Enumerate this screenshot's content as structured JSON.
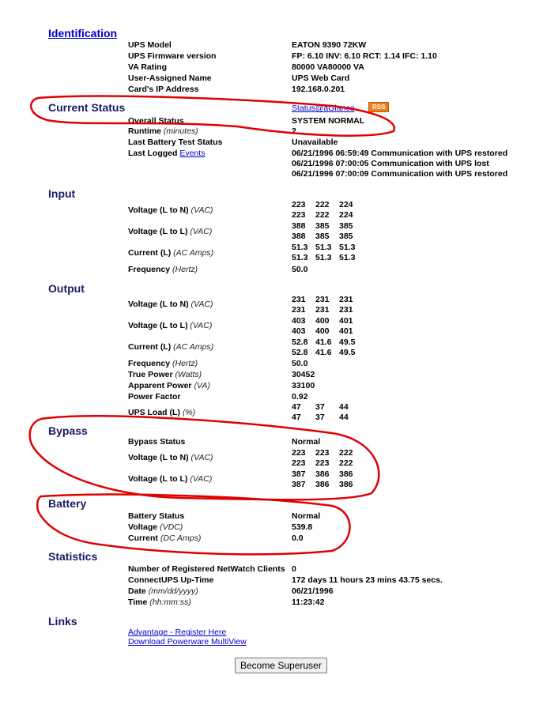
{
  "identification": {
    "header": "Identification",
    "ups_model_label": "UPS Model",
    "ups_model": "EATON 9390 72KW",
    "firmware_label": "UPS Firmware version",
    "firmware": "FP: 6.10 INV: 6.10 RCT: 1.14 IFC: 1.10",
    "va_label": "VA Rating",
    "va": "80000 VA80000 VA",
    "name_label": "User-Assigned Name",
    "name": "UPS Web Card",
    "ip_label": "Card's IP Address",
    "ip": "192.168.0.201"
  },
  "current_status": {
    "header": "Current Status",
    "glance_link": "Status@aGlance",
    "rss": "RSS",
    "overall_label": "Overall Status",
    "overall": "SYSTEM NORMAL",
    "runtime_label": "Runtime",
    "runtime_unit": "(minutes)",
    "runtime": "2",
    "battery_test_label": "Last Battery Test Status",
    "battery_test": "Unavailable",
    "events_prefix": "Last Logged",
    "events_link": "Events",
    "events": [
      "06/21/1996 06:59:49 Communication with UPS restored",
      "06/21/1996 07:00:05 Communication with UPS lost",
      "06/21/1996 07:00:09 Communication with UPS restored"
    ]
  },
  "input": {
    "header": "Input",
    "voltage_ln_label": "Voltage (L to N)",
    "voltage_ln_unit": "(VAC)",
    "voltage_ln": [
      [
        "223",
        "222",
        "224"
      ],
      [
        "223",
        "222",
        "224"
      ]
    ],
    "voltage_ll_label": "Voltage (L to L)",
    "voltage_ll_unit": "(VAC)",
    "voltage_ll": [
      [
        "388",
        "385",
        "385"
      ],
      [
        "388",
        "385",
        "385"
      ]
    ],
    "current_label": "Current (L)",
    "current_unit": "(AC Amps)",
    "current": [
      [
        "51.3",
        "51.3",
        "51.3"
      ],
      [
        "51.3",
        "51.3",
        "51.3"
      ]
    ],
    "frequency_label": "Frequency",
    "frequency_unit": "(Hertz)",
    "frequency": "50.0"
  },
  "output": {
    "header": "Output",
    "voltage_ln_label": "Voltage (L to N)",
    "voltage_ln_unit": "(VAC)",
    "voltage_ln": [
      [
        "231",
        "231",
        "231"
      ],
      [
        "231",
        "231",
        "231"
      ]
    ],
    "voltage_ll_label": "Voltage (L to L)",
    "voltage_ll_unit": "(VAC)",
    "voltage_ll": [
      [
        "403",
        "400",
        "401"
      ],
      [
        "403",
        "400",
        "401"
      ]
    ],
    "current_label": "Current (L)",
    "current_unit": "(AC Amps)",
    "current": [
      [
        "52.8",
        "41.6",
        "49.5"
      ],
      [
        "52.8",
        "41.6",
        "49.5"
      ]
    ],
    "frequency_label": "Frequency",
    "frequency_unit": "(Hertz)",
    "frequency": "50.0",
    "true_power_label": "True Power",
    "true_power_unit": "(Watts)",
    "true_power": "30452",
    "apparent_power_label": "Apparent Power",
    "apparent_power_unit": "(VA)",
    "apparent_power": "33100",
    "power_factor_label": "Power Factor",
    "power_factor": "0.92",
    "load_label": "UPS Load (L)",
    "load_unit": "(%)",
    "load": [
      [
        "47",
        "37",
        "44"
      ],
      [
        "47",
        "37",
        "44"
      ]
    ]
  },
  "bypass": {
    "header": "Bypass",
    "status_label": "Bypass Status",
    "status": "Normal",
    "voltage_ln_label": "Voltage (L to N)",
    "voltage_ln_unit": "(VAC)",
    "voltage_ln": [
      [
        "223",
        "223",
        "222"
      ],
      [
        "223",
        "223",
        "222"
      ]
    ],
    "voltage_ll_label": "Voltage (L to L)",
    "voltage_ll_unit": "(VAC)",
    "voltage_ll": [
      [
        "387",
        "386",
        "386"
      ],
      [
        "387",
        "386",
        "386"
      ]
    ]
  },
  "battery": {
    "header": "Battery",
    "status_label": "Battery Status",
    "status": "Normal",
    "voltage_label": "Voltage",
    "voltage_unit": "(VDC)",
    "voltage": "539.8",
    "current_label": "Current",
    "current_unit": "(DC Amps)",
    "current": "0.0"
  },
  "statistics": {
    "header": "Statistics",
    "clients_label": "Number of Registered NetWatch Clients",
    "clients": "0",
    "uptime_label": "ConnectUPS Up-Time",
    "uptime": "172 days 11 hours 23 mins 43.75 secs.",
    "date_label": "Date",
    "date_unit": "(mm/dd/yyyy)",
    "date": "06/21/1996",
    "time_label": "Time",
    "time_unit": "(hh:mm:ss)",
    "time": "11:23:42"
  },
  "links": {
    "header": "Links",
    "items": [
      "Advantage - Register Here",
      "Download Powerware MultiView"
    ]
  },
  "superuser_button": "Become Superuser",
  "colors": {
    "header": "#1a1a66",
    "link": "#0000cc",
    "rss": "#f07c20",
    "annotation": "#e00000"
  }
}
